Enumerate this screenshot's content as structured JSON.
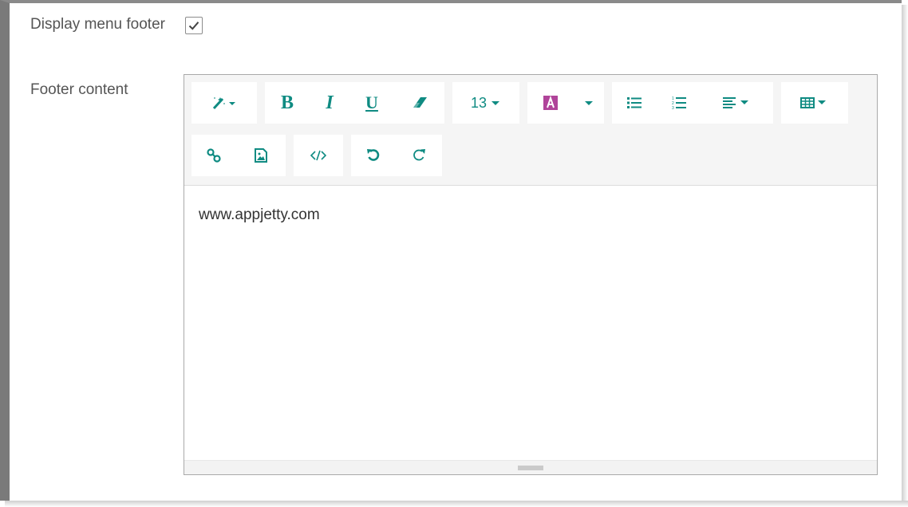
{
  "form": {
    "display_menu_footer": {
      "label": "Display menu footer",
      "checked": true
    },
    "footer_content": {
      "label": "Footer content",
      "value": "www.appjetty.com"
    }
  },
  "toolbar": {
    "font_size": "13",
    "icons": [
      "magic-wand-icon",
      "bold-icon",
      "italic-icon",
      "underline-icon",
      "eraser-icon",
      "font-size-dropdown",
      "font-color-icon",
      "unordered-list-icon",
      "ordered-list-icon",
      "paragraph-align-icon",
      "table-icon",
      "link-icon",
      "picture-icon",
      "code-view-icon",
      "undo-icon",
      "redo-icon"
    ],
    "bold_label": "B",
    "italic_label": "I",
    "underline_label": "U"
  },
  "colors": {
    "accent": "#0f8b82",
    "font_color_swatch": "#b0449a",
    "label_text": "#555555"
  }
}
